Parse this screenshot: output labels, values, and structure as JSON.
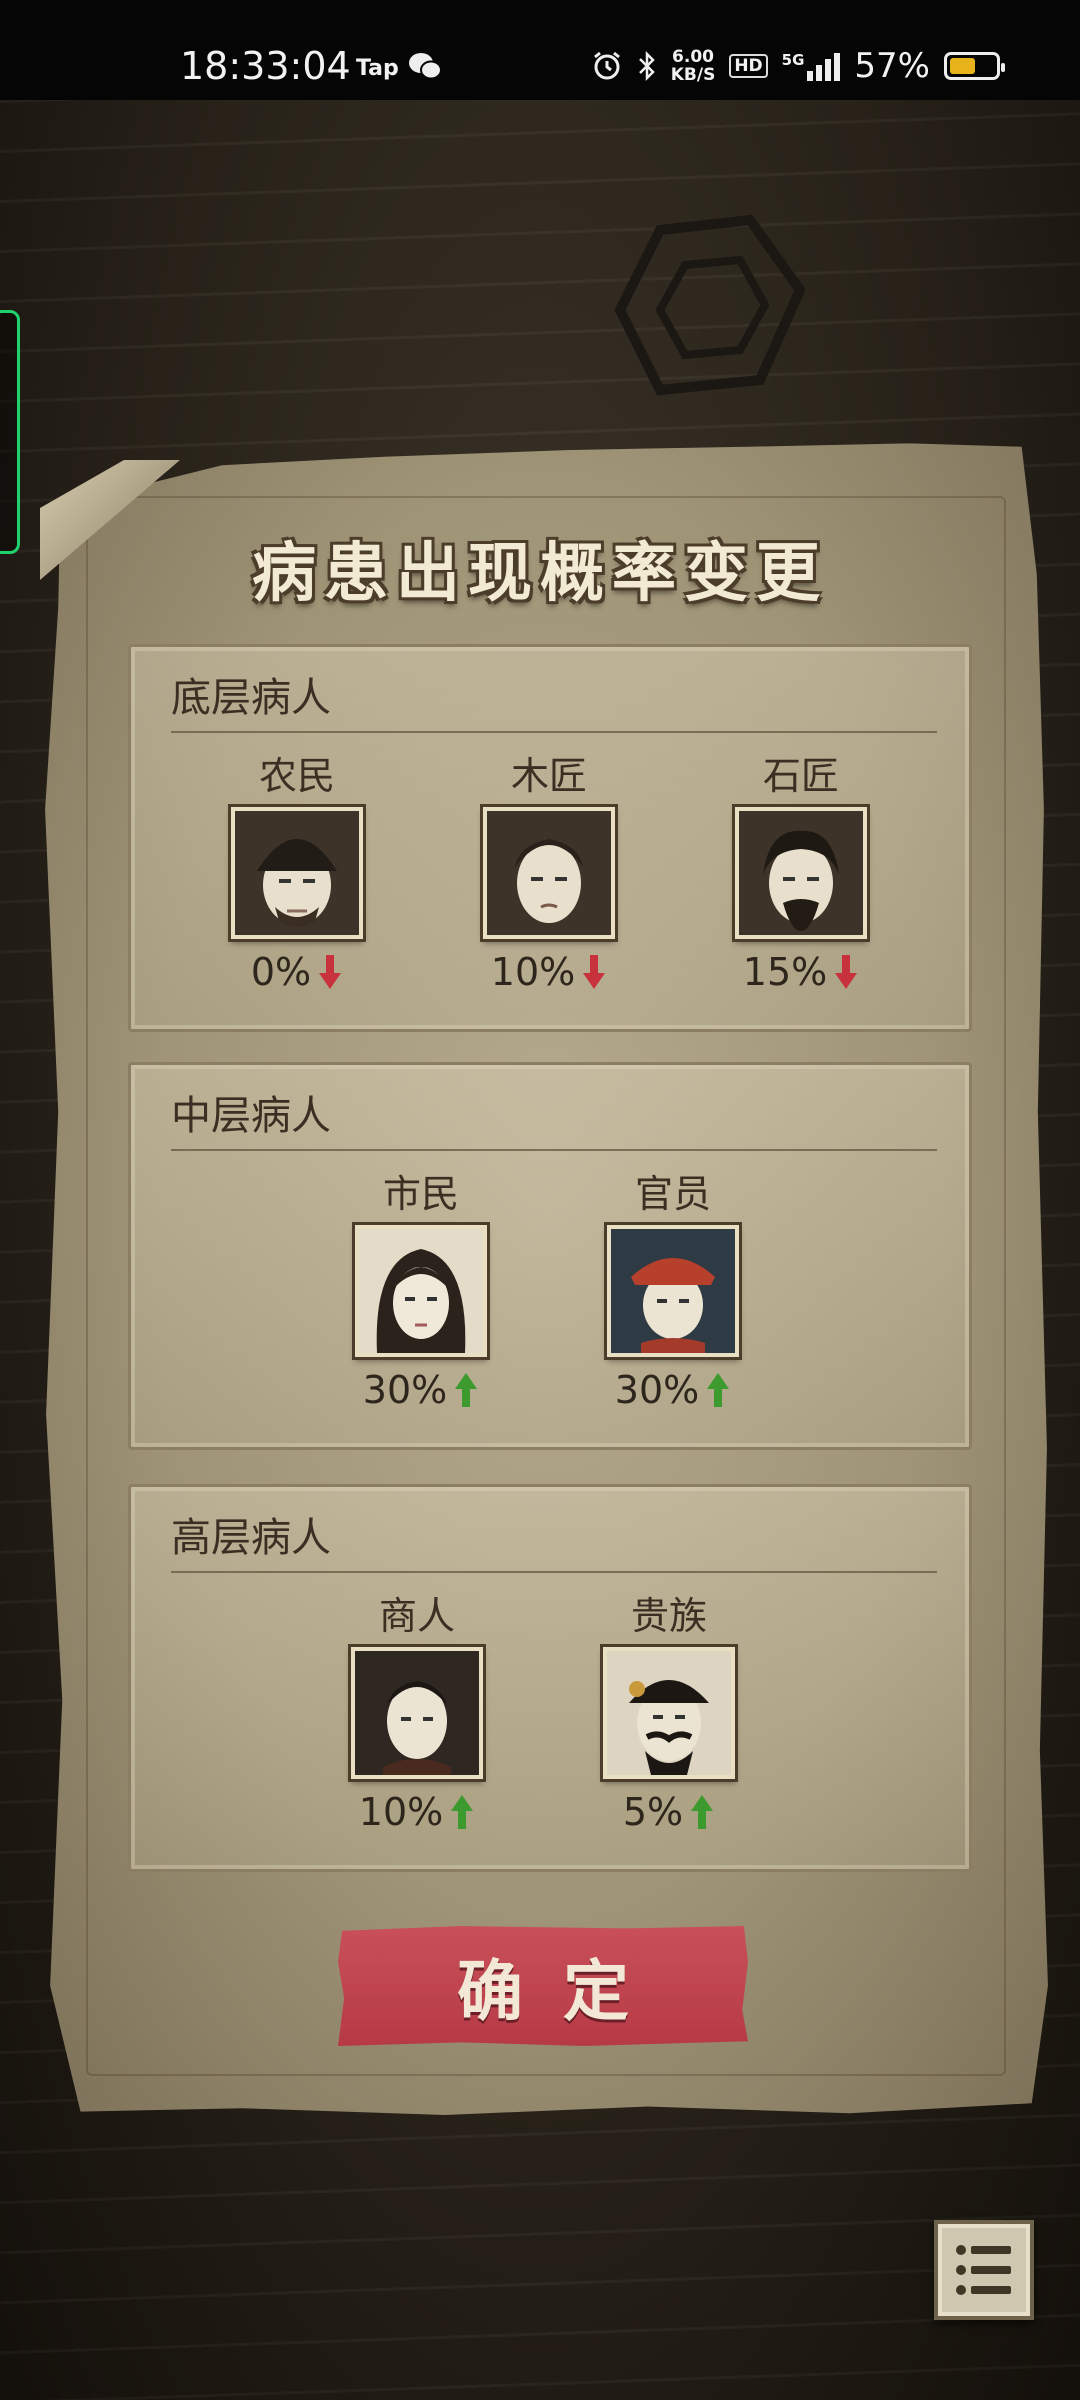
{
  "status_bar": {
    "time": "18:33:04",
    "app_label": "Tap",
    "net_speed_value": "6.00",
    "net_speed_unit": "KB/S",
    "hd_label": "HD",
    "network_label": "5G",
    "battery_percent": "57%",
    "battery_level": 0.57,
    "battery_color": "#e8b21b"
  },
  "dialog": {
    "title": "病患出现概率变更",
    "sections": [
      {
        "title": "底层病人",
        "patients": [
          {
            "name": "农民",
            "percent": "0%",
            "trend": "down"
          },
          {
            "name": "木匠",
            "percent": "10%",
            "trend": "down"
          },
          {
            "name": "石匠",
            "percent": "15%",
            "trend": "down"
          }
        ]
      },
      {
        "title": "中层病人",
        "patients": [
          {
            "name": "市民",
            "percent": "30%",
            "trend": "up"
          },
          {
            "name": "官员",
            "percent": "30%",
            "trend": "up"
          }
        ]
      },
      {
        "title": "高层病人",
        "patients": [
          {
            "name": "商人",
            "percent": "10%",
            "trend": "up"
          },
          {
            "name": "贵族",
            "percent": "5%",
            "trend": "up"
          }
        ]
      }
    ],
    "confirm_label": "确定"
  },
  "colors": {
    "down_arrow": "#c8323c",
    "up_arrow": "#3c9a2e",
    "confirm_button": "#bf4450"
  }
}
